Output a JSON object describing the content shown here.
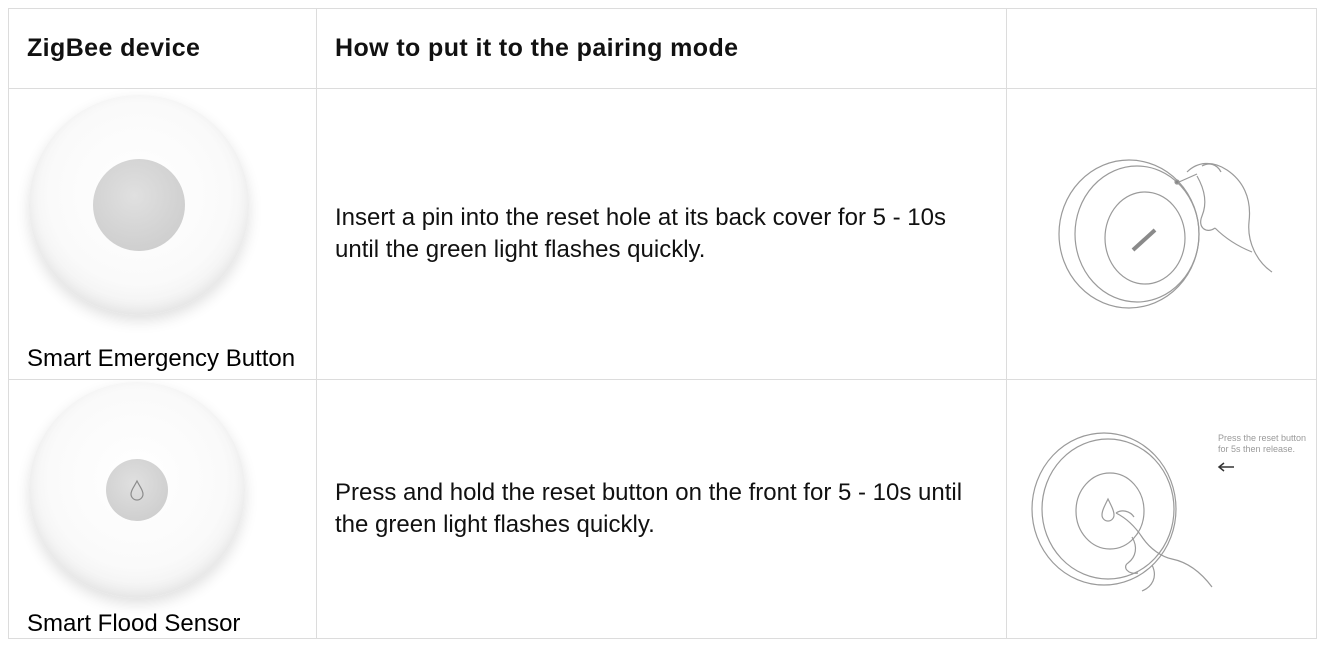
{
  "table": {
    "headers": {
      "device": "ZigBee device",
      "pairing": "How to put it to the pairing mode",
      "image": ""
    },
    "rows": [
      {
        "device_name": "Smart Emergency Button",
        "instruction": "Insert a pin into the reset hole at its back cover for 5 - 10s until the green light flashes quickly.",
        "illustration_icon": "pin-reset-back-cover-illustration"
      },
      {
        "device_name": "Smart Flood Sensor",
        "instruction": "Press and hold the reset button on the front for 5 - 10s until the green light flashes quickly.",
        "illustration_icon": "press-reset-button-illustration",
        "illustration_caption": "Press the reset button for 5s then release."
      }
    ]
  },
  "colors": {
    "border": "#dcdcdc",
    "text": "#111111",
    "device_body": "#f8f8f8",
    "device_button": "#d2d2d2"
  }
}
